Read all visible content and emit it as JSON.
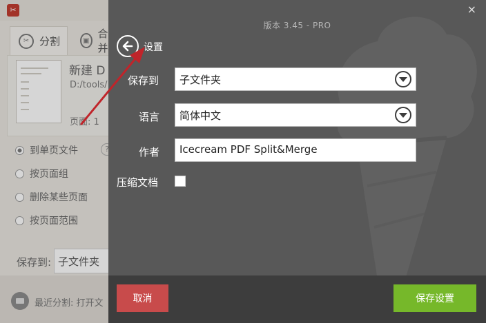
{
  "app": {
    "tabs": [
      {
        "label": "分割",
        "icon": "scissors-icon"
      },
      {
        "label": "合并",
        "icon": "merge-icon"
      }
    ],
    "document": {
      "name": "新建 D",
      "path": "D:/tools/",
      "pages": "页面: 1"
    },
    "split_modes": [
      "到单页文件",
      "按页面组",
      "删除某些页面",
      "按页面范围"
    ],
    "save_to_label": "保存到:",
    "save_to_value": "子文件夹",
    "recent_split": "最近分割: 打开文"
  },
  "settings": {
    "version": "版本 3.45 - PRO",
    "title": "设置",
    "close_symbol": "×",
    "save_to": {
      "label": "保存到",
      "value": "子文件夹"
    },
    "language": {
      "label": "语言",
      "value": "简体中文"
    },
    "author": {
      "label": "作者",
      "value": "Icecream PDF Split&Merge"
    },
    "compress": {
      "label": "压缩文档",
      "checked": false
    },
    "cancel_label": "取消",
    "save_label": "保存设置"
  },
  "colors": {
    "overlay_bg": "#585858",
    "footer_bg": "#3d3d3d",
    "cancel": "#c84b4b",
    "save": "#76b82a",
    "annotation_arrow": "#c0242a"
  }
}
